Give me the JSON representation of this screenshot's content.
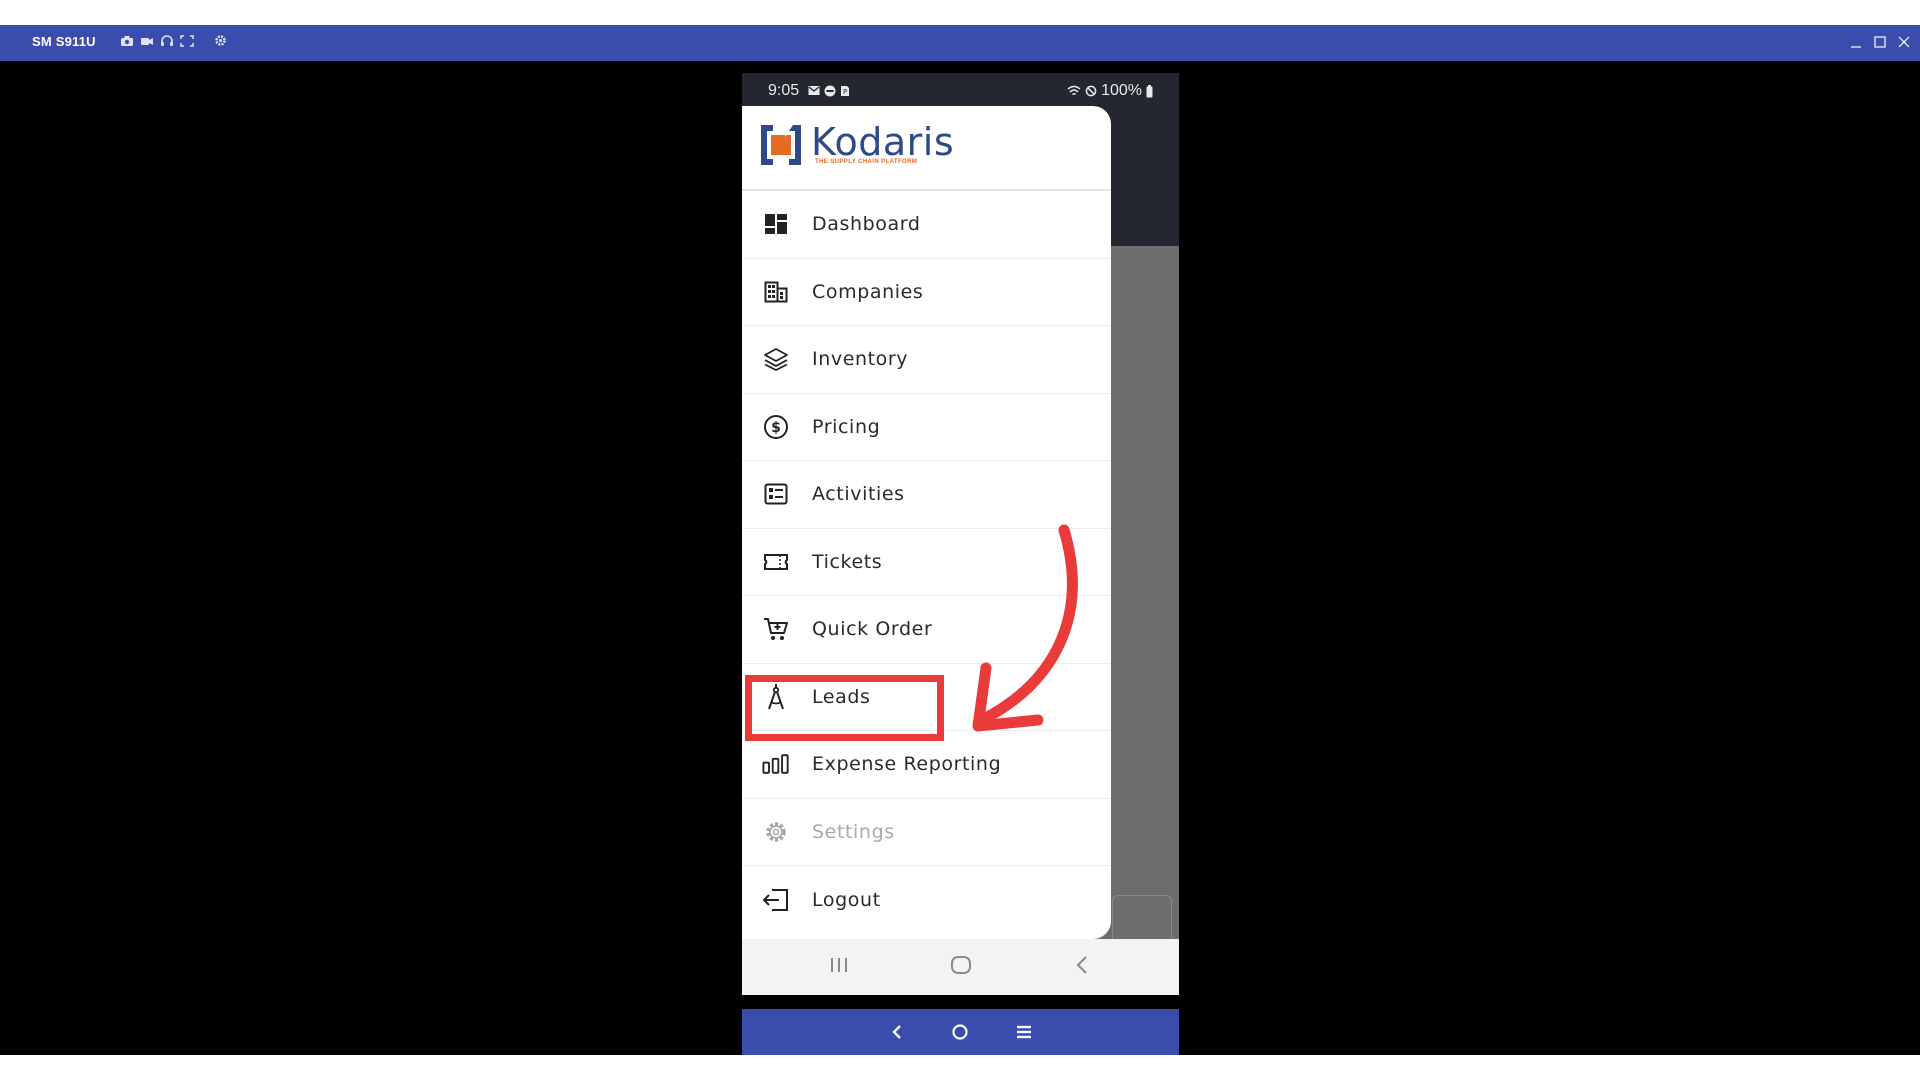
{
  "window": {
    "device_name": "SM S911U",
    "tool_icons": [
      "camera-icon",
      "video-icon",
      "headset-icon",
      "fullscreen-icon",
      "gear-icon"
    ],
    "controls": [
      "minimize-icon",
      "maximize-icon",
      "close-icon"
    ]
  },
  "statusbar": {
    "time": "9:05",
    "battery": "100%"
  },
  "drawer": {
    "logo_name": "Kodaris",
    "logo_tagline": "THE SUPPLY CHAIN PLATFORM",
    "items": [
      {
        "label": "Dashboard",
        "icon": "dashboard-icon",
        "enabled": true
      },
      {
        "label": "Companies",
        "icon": "building-icon",
        "enabled": true
      },
      {
        "label": "Inventory",
        "icon": "layers-icon",
        "enabled": true
      },
      {
        "label": "Pricing",
        "icon": "dollar-circle-icon",
        "enabled": true
      },
      {
        "label": "Activities",
        "icon": "activity-list-icon",
        "enabled": true
      },
      {
        "label": "Tickets",
        "icon": "ticket-icon",
        "enabled": true
      },
      {
        "label": "Quick Order",
        "icon": "cart-icon",
        "enabled": true
      },
      {
        "label": "Leads",
        "icon": "compass-tool-icon",
        "enabled": true
      },
      {
        "label": "Expense Reporting",
        "icon": "bar-chart-icon",
        "enabled": true
      },
      {
        "label": "Settings",
        "icon": "gear-icon",
        "enabled": false
      },
      {
        "label": "Logout",
        "icon": "logout-icon",
        "enabled": true
      }
    ]
  },
  "annotation": {
    "highlighted_item": "Leads",
    "color": "#ea3b3b"
  },
  "colors": {
    "titlebar": "#3a4dad",
    "brand_blue": "#2c4a86",
    "brand_orange": "#e56a24"
  }
}
